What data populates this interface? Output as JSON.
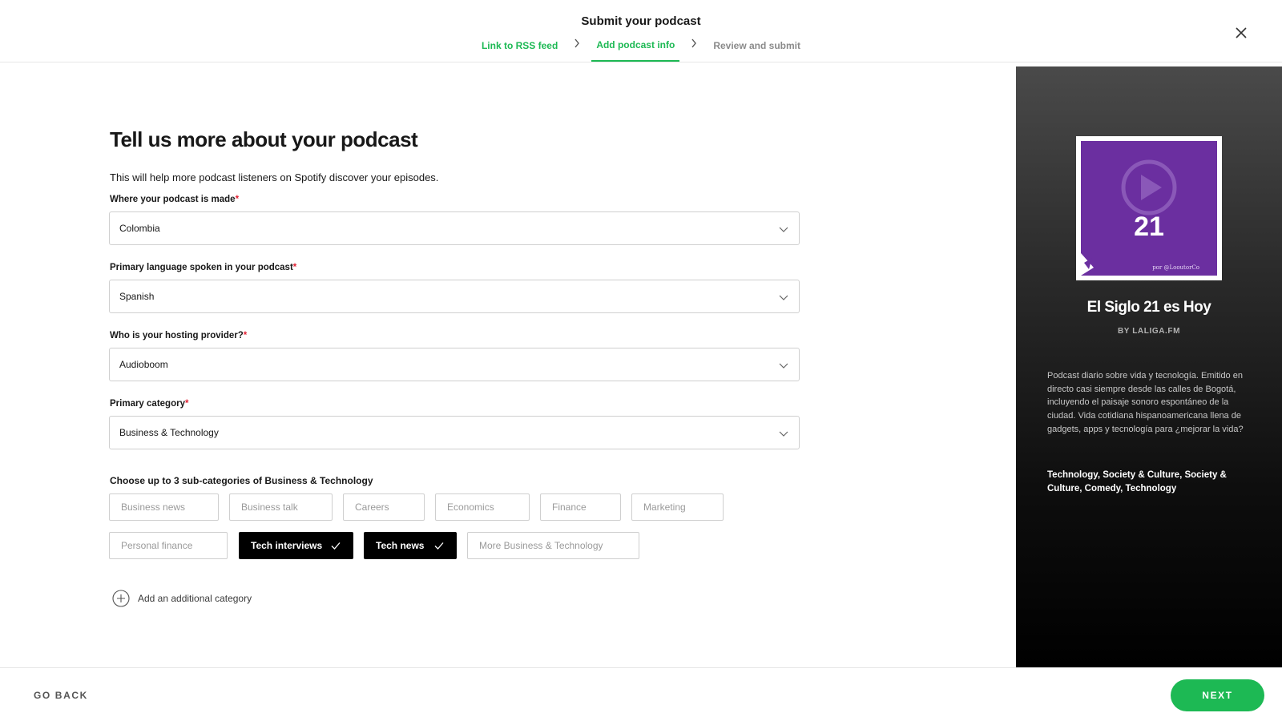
{
  "header": {
    "title": "Submit your podcast",
    "steps": [
      {
        "label": "Link to RSS feed",
        "state": "done"
      },
      {
        "label": "Add podcast info",
        "state": "active"
      },
      {
        "label": "Review and submit",
        "state": "todo"
      }
    ],
    "close_icon": "close-icon"
  },
  "form": {
    "title": "Tell us more about your podcast",
    "intro": "This will help more podcast listeners on Spotify discover your episodes.",
    "fields": [
      {
        "label": "Where your podcast is made",
        "required_mark": "*",
        "value": "Colombia"
      },
      {
        "label": "Primary language spoken in your podcast",
        "required_mark": "*",
        "value": "Spanish"
      },
      {
        "label": "Who is your hosting provider?",
        "required_mark": "*",
        "value": "Audioboom"
      },
      {
        "label": "Primary category",
        "required_mark": "*",
        "value": "Business & Technology"
      }
    ],
    "subcategories_label": "Choose up to 3 sub-categories of Business & Technology",
    "subcategories": [
      {
        "label": "Business news",
        "selected": false
      },
      {
        "label": "Business talk",
        "selected": false
      },
      {
        "label": "Careers",
        "selected": false
      },
      {
        "label": "Economics",
        "selected": false
      },
      {
        "label": "Finance",
        "selected": false
      },
      {
        "label": "Marketing",
        "selected": false
      },
      {
        "label": "Personal finance",
        "selected": false
      },
      {
        "label": "Tech interviews",
        "selected": true
      },
      {
        "label": "Tech news",
        "selected": true
      },
      {
        "label": "More Business & Technology",
        "selected": false
      }
    ],
    "add_category": "Add an additional category"
  },
  "preview": {
    "cover_number": "21",
    "cover_credit": "por @LooutorCo",
    "title": "El Siglo 21 es Hoy",
    "author": "BY LALIGA.FM",
    "description": "Podcast diario sobre vida y tecnología. Emitido en directo casi siempre desde las calles de Bogotá, incluyendo el paisaje sonoro espontáneo de la ciudad. Vida cotidiana hispanoamericana llena de gadgets, apps y tecnología para ¿mejorar la vida?",
    "categories": "Technology, Society & Culture, Society & Culture, Comedy, Technology"
  },
  "footer": {
    "back_label": "GO BACK",
    "next_label": "NEXT"
  },
  "colors": {
    "accent": "#1db954",
    "required": "#e22134",
    "cover": "#6b2fa0"
  }
}
